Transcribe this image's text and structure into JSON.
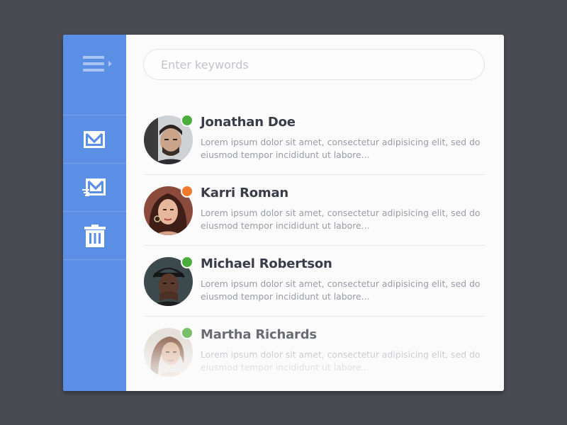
{
  "sidebar": {
    "menu_icon": "menu-icon",
    "items": [
      {
        "name": "inbox",
        "icon": "envelope-icon"
      },
      {
        "name": "sent",
        "icon": "send-mail-icon"
      },
      {
        "name": "trash",
        "icon": "trash-icon"
      }
    ]
  },
  "search": {
    "placeholder": "Enter keywords",
    "value": ""
  },
  "messages": [
    {
      "name": "Jonathan Doe",
      "preview": "Lorem ipsum dolor sit amet, consectetur adipisicing elit, sed do eiusmod tempor incididunt ut labore...",
      "status": "online"
    },
    {
      "name": "Karri Roman",
      "preview": "Lorem ipsum dolor sit amet, consectetur adipisicing elit, sed do eiusmod tempor incididunt ut labore...",
      "status": "away"
    },
    {
      "name": "Michael Robertson",
      "preview": "Lorem ipsum dolor sit amet, consectetur adipisicing elit, sed do eiusmod tempor incididunt ut labore...",
      "status": "online"
    },
    {
      "name": "Martha Richards",
      "preview": "Lorem ipsum dolor sit amet, consectetur adipisicing elit, sed do eiusmod tempor incididunt ut labore...",
      "status": "online"
    }
  ],
  "colors": {
    "background": "#4a4a53",
    "sidebar": "#5b8fe6",
    "status_online": "#4cae3c",
    "status_away": "#f07a2c"
  }
}
